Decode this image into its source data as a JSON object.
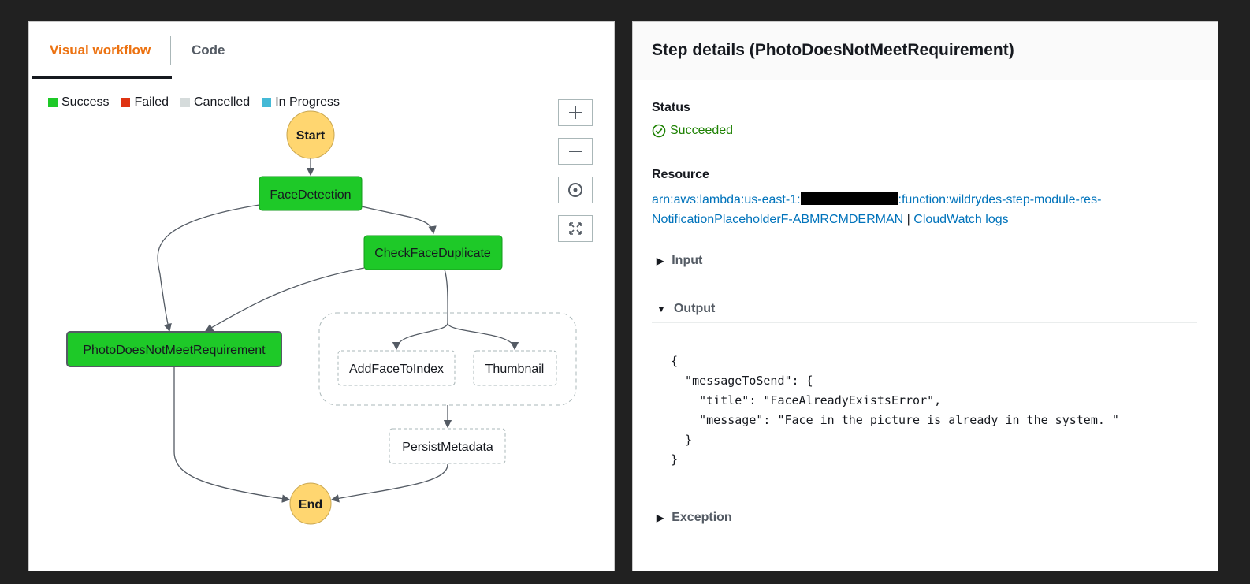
{
  "left_panel": {
    "tabs": [
      {
        "label": "Visual workflow",
        "active": true
      },
      {
        "label": "Code",
        "active": false
      }
    ],
    "legend": [
      {
        "label": "Success",
        "color": "#1ec928"
      },
      {
        "label": "Failed",
        "color": "#df3312"
      },
      {
        "label": "Cancelled",
        "color": "#d5dbdb"
      },
      {
        "label": "In Progress",
        "color": "#44b9d6"
      }
    ],
    "zoom_controls": [
      {
        "icon": "plus-icon"
      },
      {
        "icon": "minus-icon"
      },
      {
        "icon": "center-target-icon"
      },
      {
        "icon": "fit-to-screen-icon"
      }
    ],
    "workflow": {
      "nodes": {
        "start": "Start",
        "face_detection": "FaceDetection",
        "check_face_duplicate": "CheckFaceDuplicate",
        "photo_does_not_meet": "PhotoDoesNotMeetRequirement",
        "add_face_to_index": "AddFaceToIndex",
        "thumbnail": "Thumbnail",
        "persist_metadata": "PersistMetadata",
        "end": "End"
      },
      "colors": {
        "success": "#1ec928",
        "terminal": "#ffd670",
        "not_run_border": "#aab7b8"
      }
    }
  },
  "right_panel": {
    "title": "Step details (PhotoDoesNotMeetRequirement)",
    "status_label": "Status",
    "status_value": "Succeeded",
    "resource_label": "Resource",
    "resource_prefix": "arn:aws:lambda:us-east-1:",
    "resource_suffix": ":function:wildrydes-step-module-res-NotificationPlaceholderF-ABMRCMDERMAN",
    "separator": "|",
    "cloudwatch_link": "CloudWatch logs",
    "sections": {
      "input": "Input",
      "output": "Output",
      "exception": "Exception"
    },
    "output_json": "{\n  \"messageToSend\": {\n    \"title\": \"FaceAlreadyExistsError\",\n    \"message\": \"Face in the picture is already in the system. \"\n  }\n}"
  }
}
